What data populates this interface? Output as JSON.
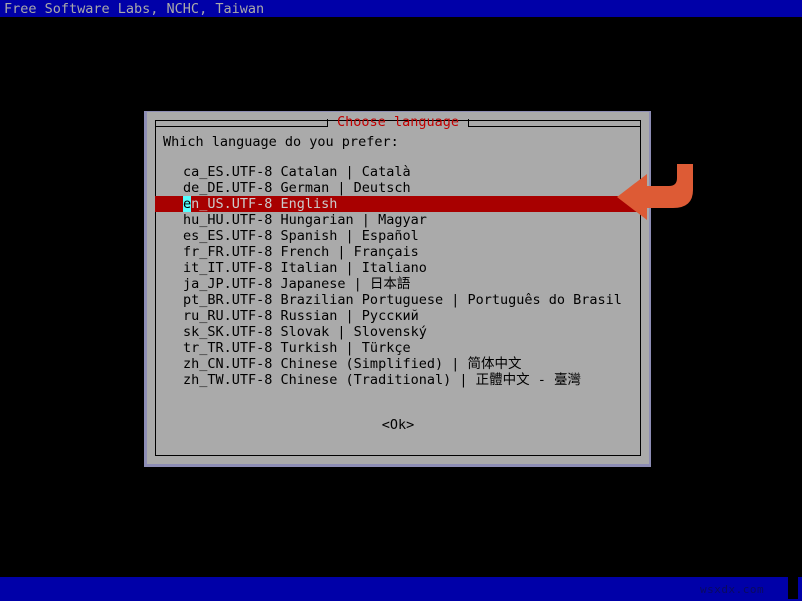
{
  "banner": {
    "text": "Free Software Labs, NCHC, Taiwan"
  },
  "dialog": {
    "title": "Choose language",
    "prompt": "Which language do you prefer:",
    "ok_label": "<Ok>",
    "colors": {
      "background": "#aaaaaa",
      "title": "#c00000",
      "selection_bg": "#a80000",
      "selection_fg": "#cccccc",
      "cursor": "#55ffff",
      "screen_bg": "#0000a8"
    }
  },
  "languages": [
    {
      "locale": "ca_ES.UTF-8",
      "name": "Catalan",
      "native": "Català",
      "line": "ca_ES.UTF-8 Catalan | Català",
      "selected": false
    },
    {
      "locale": "de_DE.UTF-8",
      "name": "German",
      "native": "Deutsch",
      "line": "de_DE.UTF-8 German | Deutsch",
      "selected": false
    },
    {
      "locale": "en_US.UTF-8",
      "name": "English",
      "native": "",
      "line": "en_US.UTF-8 English",
      "selected": true,
      "cursor_char": "e",
      "rest": "n_US.UTF-8 English"
    },
    {
      "locale": "hu_HU.UTF-8",
      "name": "Hungarian",
      "native": "Magyar",
      "line": "hu_HU.UTF-8 Hungarian | Magyar",
      "selected": false
    },
    {
      "locale": "es_ES.UTF-8",
      "name": "Spanish",
      "native": "Español",
      "line": "es_ES.UTF-8 Spanish | Español",
      "selected": false
    },
    {
      "locale": "fr_FR.UTF-8",
      "name": "French",
      "native": "Français",
      "line": "fr_FR.UTF-8 French | Français",
      "selected": false
    },
    {
      "locale": "it_IT.UTF-8",
      "name": "Italian",
      "native": "Italiano",
      "line": "it_IT.UTF-8 Italian | Italiano",
      "selected": false
    },
    {
      "locale": "ja_JP.UTF-8",
      "name": "Japanese",
      "native": "日本語",
      "line": "ja_JP.UTF-8 Japanese | 日本語",
      "selected": false
    },
    {
      "locale": "pt_BR.UTF-8",
      "name": "Brazilian Portuguese",
      "native": "Português do Brasil",
      "line": "pt_BR.UTF-8 Brazilian Portuguese | Português do Brasil",
      "selected": false
    },
    {
      "locale": "ru_RU.UTF-8",
      "name": "Russian",
      "native": "Русский",
      "line": "ru_RU.UTF-8 Russian | Русский",
      "selected": false
    },
    {
      "locale": "sk_SK.UTF-8",
      "name": "Slovak",
      "native": "Slovenský",
      "line": "sk_SK.UTF-8 Slovak | Slovenský",
      "selected": false
    },
    {
      "locale": "tr_TR.UTF-8",
      "name": "Turkish",
      "native": "Türkçe",
      "line": "tr_TR.UTF-8 Turkish | Türkçe",
      "selected": false
    },
    {
      "locale": "zh_CN.UTF-8",
      "name": "Chinese (Simplified)",
      "native": "简体中文",
      "line": "zh_CN.UTF-8 Chinese (Simplified) | 简体中文",
      "selected": false
    },
    {
      "locale": "zh_TW.UTF-8",
      "name": "Chinese (Traditional)",
      "native": "正體中文 - 臺灣",
      "line": "zh_TW.UTF-8 Chinese (Traditional) | 正體中文 - 臺灣",
      "selected": false
    }
  ],
  "annotation": {
    "arrow_color": "#dd5b35",
    "points_at": "en_US.UTF-8 English"
  },
  "watermark": {
    "text": "wsxdx.com"
  }
}
